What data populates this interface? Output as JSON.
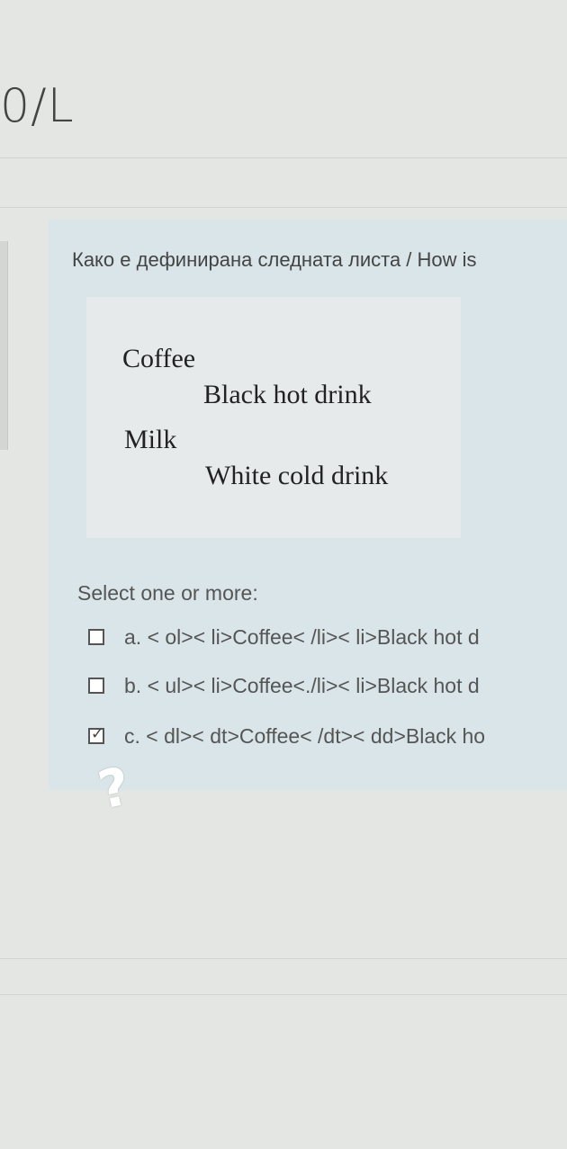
{
  "header": {
    "title": "0/L"
  },
  "question": {
    "text": "Како е дефинирана следната листа / How is",
    "list": {
      "terms": [
        {
          "term": "Coffee",
          "definition": "Black hot drink"
        },
        {
          "term": "Milk",
          "definition": "White cold drink"
        }
      ]
    },
    "prompt": "Select one or more:",
    "options": [
      {
        "label": "a. < ol>< li>Coffee< /li>< li>Black hot d",
        "checked": false
      },
      {
        "label": "b. < ul>< li>Coffee<./li>< li>Black hot d",
        "checked": false
      },
      {
        "label": "c. < dl>< dt>Coffee< /dt>< dd>Black ho",
        "checked": true
      }
    ]
  },
  "overlay": {
    "mark": "?"
  },
  "colors": {
    "background": "#e4e6e4",
    "card": "#d9e5e8",
    "list_box": "#e7eaea"
  }
}
